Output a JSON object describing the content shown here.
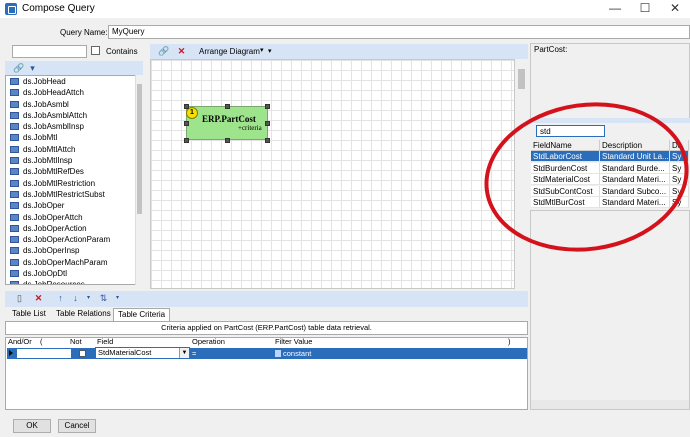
{
  "window": {
    "title": "Compose Query",
    "minimize": "—",
    "maximize": "☐",
    "close": "✕"
  },
  "query": {
    "name_label": "Query Name:",
    "name_value": "MyQuery"
  },
  "left": {
    "contains_label": "Contains",
    "tables": [
      "ds.JobHead",
      "ds.JobHeadAttch",
      "ds.JobAsmbl",
      "ds.JobAsmblAttch",
      "ds.JobAsmblInsp",
      "ds.JobMtl",
      "ds.JobMtlAttch",
      "ds.JobMtlInsp",
      "ds.JobMtlRefDes",
      "ds.JobMtlRestriction",
      "ds.JobMtlRestrictSubst",
      "ds.JobOper",
      "ds.JobOperAttch",
      "ds.JobOperAction",
      "ds.JobOperActionParam",
      "ds.JobOperInsp",
      "ds.JobOperMachParam",
      "ds.JobOpDtl",
      "ds.JobResources"
    ]
  },
  "diagram": {
    "arrange_label": "Arrange Diagram",
    "node": {
      "badge": "1",
      "title": "ERP.PartCost",
      "subtitle": "+criteria"
    }
  },
  "right": {
    "panel_label": "PartCost:",
    "search_value": "std",
    "columns": [
      "FieldName",
      "Description",
      "Da"
    ],
    "rows": [
      {
        "field": "StdLaborCost",
        "desc": "Standard Unit La...",
        "da": "Sy"
      },
      {
        "field": "StdBurdenCost",
        "desc": "Standard Burde...",
        "da": "Sy"
      },
      {
        "field": "StdMaterialCost",
        "desc": "Standard Materi...",
        "da": "Sy"
      },
      {
        "field": "StdSubContCost",
        "desc": "Standard Subco...",
        "da": "Sy"
      },
      {
        "field": "StdMtlBurCost",
        "desc": "Standard Materi...",
        "da": "Sy"
      }
    ]
  },
  "bottom": {
    "tabs": [
      "Table List",
      "Table Relations",
      "Table Criteria"
    ],
    "criteria_header": "Criteria applied on PartCost (ERP.PartCost)  table data retrieval.",
    "columns": {
      "andor": "And/Or",
      "open": "(",
      "not": "Not",
      "field": "Field",
      "operation": "Operation",
      "filter": "Filter Value",
      "close": ")"
    },
    "row": {
      "field": "StdMaterialCost",
      "operation": "=",
      "filter": "constant"
    }
  },
  "buttons": {
    "ok": "OK",
    "cancel": "Cancel"
  },
  "colors": {
    "accent": "#2a6ebb",
    "annotation": "#d3121b",
    "node": "#9ee48c"
  }
}
